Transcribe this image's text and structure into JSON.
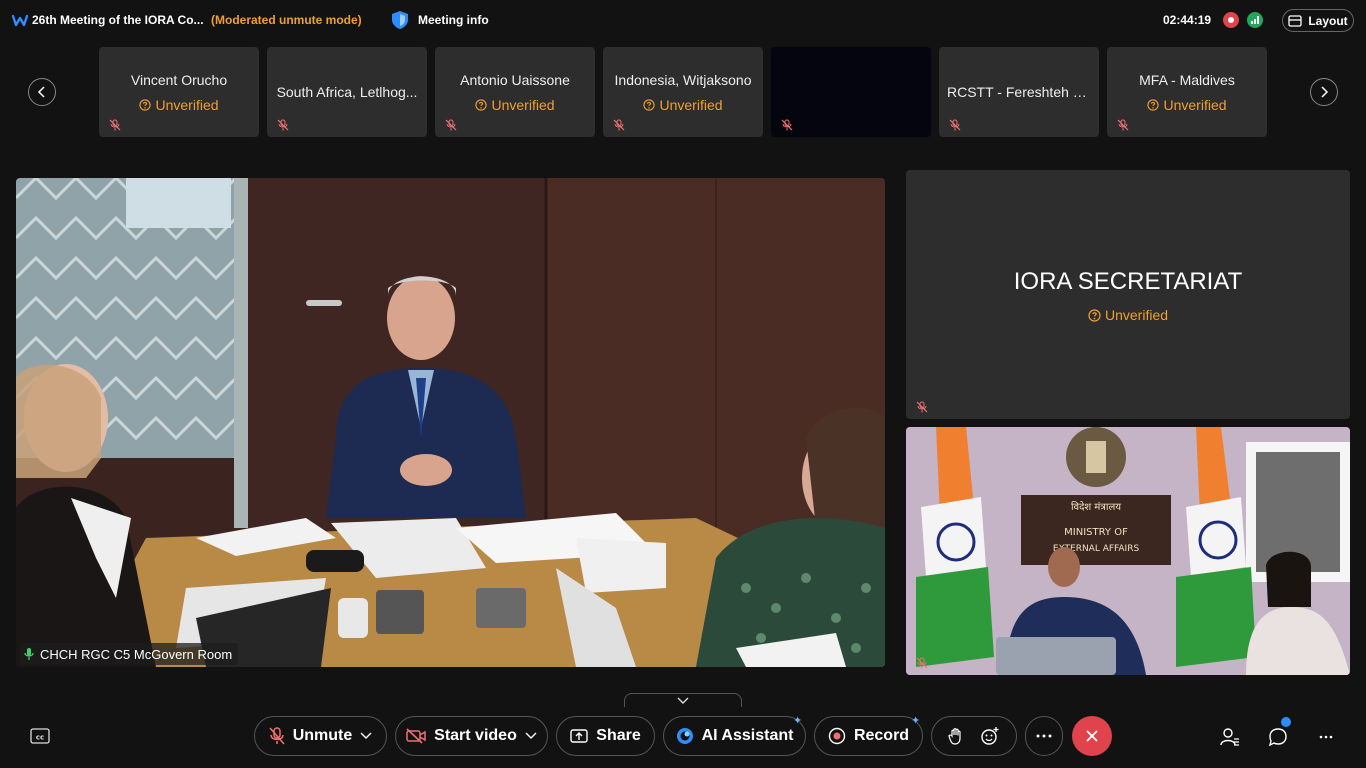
{
  "header": {
    "meeting_title": "26th Meeting of the IORA Co...",
    "unmute_mode": "(Moderated unmute mode)",
    "meeting_info_label": "Meeting info",
    "clock": "02:44:19",
    "layout_label": "Layout"
  },
  "filmstrip": [
    {
      "name": "Vincent Orucho",
      "status": "Unverified"
    },
    {
      "name": "South Africa, Letlhog...",
      "status": ""
    },
    {
      "name": "Antonio Uaissone",
      "status": "Unverified"
    },
    {
      "name": "Indonesia, Witjaksono",
      "status": "Unverified"
    },
    {
      "name": "",
      "status": ""
    },
    {
      "name": "RCSTT - Fereshteh M...",
      "status": ""
    },
    {
      "name": "MFA - Maldives",
      "status": "Unverified"
    }
  ],
  "main_video": {
    "name_tag": "CHCH RGC C5 McGovern Room"
  },
  "secretariat": {
    "name": "IORA SECRETARIAT",
    "status": "Unverified"
  },
  "india_video": {
    "sign_line1": "विदेश मंत्रालय",
    "sign_line2": "MINISTRY OF",
    "sign_line3": "EXTERNAL AFFAIRS"
  },
  "controls": {
    "unmute_label": "Unmute",
    "start_video_label": "Start video",
    "share_label": "Share",
    "ai_assistant_label": "AI Assistant",
    "record_label": "Record"
  },
  "colors": {
    "warning": "#f0a030",
    "end_call": "#e0434b",
    "accent": "#2f8cff"
  }
}
